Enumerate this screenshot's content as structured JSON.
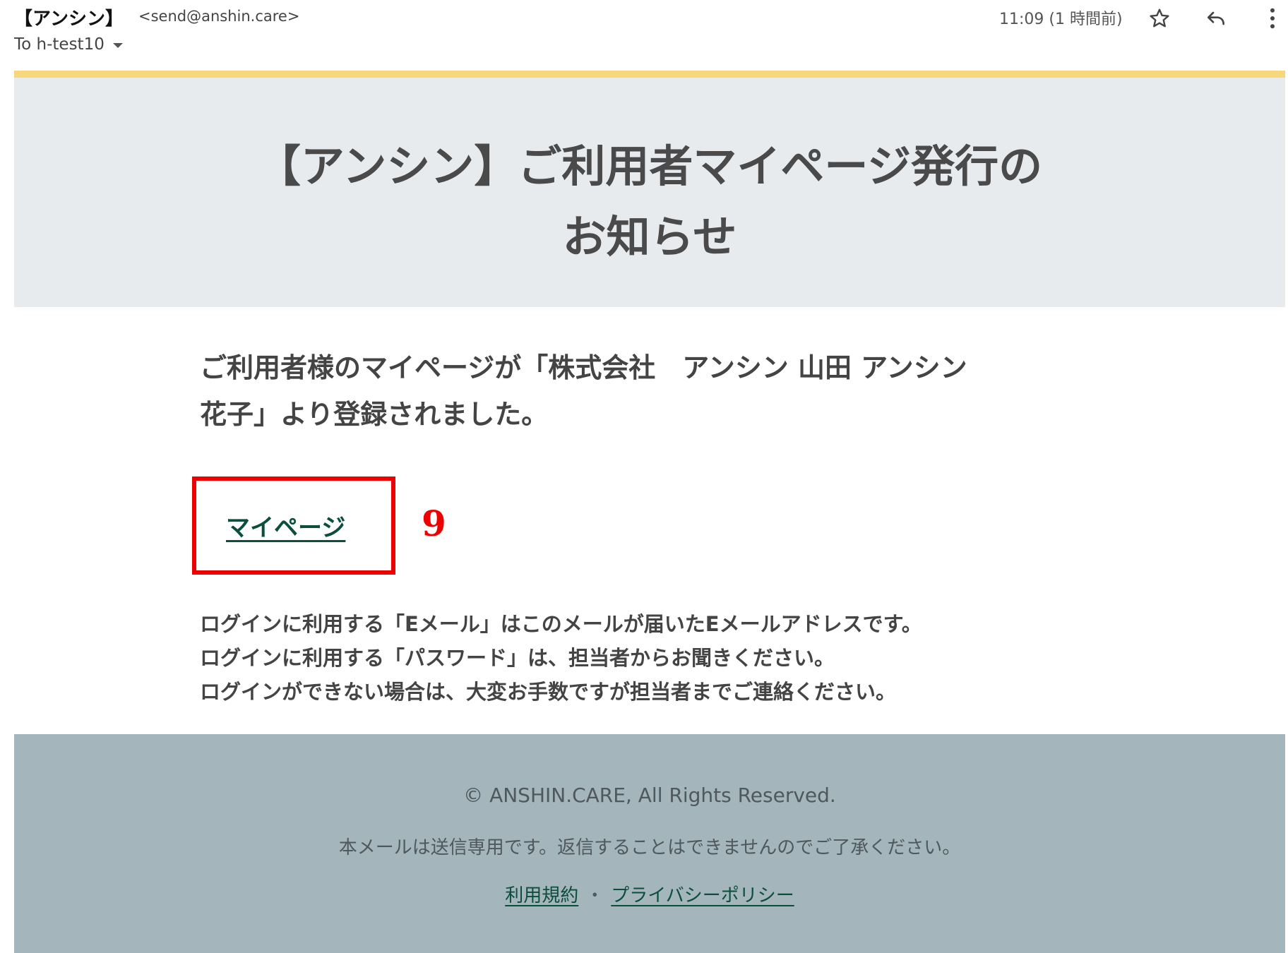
{
  "header": {
    "sender_name": "【アンシン】",
    "sender_email": "<send@anshin.care>",
    "recipient": "To h-test10",
    "timestamp": "11:09 (1 時間前)",
    "icons": [
      "star-icon",
      "reply-icon",
      "more-vert-icon",
      "chevron-down-icon"
    ]
  },
  "email": {
    "title_line1": "【アンシン】ご利用者マイページ発行の",
    "title_line2": "お知らせ",
    "intro_line1": "ご利用者様のマイページが「株式会社　アンシン 山田 アンシン",
    "intro_line2": "花子」より登録されました。",
    "mypage_link": "マイページ",
    "annotation_number": "9",
    "notes": [
      "ログインに利用する「Eメール」はこのメールが届いたEメールアドレスです。",
      "ログインに利用する「パスワード」は、担当者からお聞きください。",
      "ログインができない場合は、大変お手数ですが担当者までご連絡ください。"
    ]
  },
  "footer": {
    "copyright": "© ANSHIN.CARE, All Rights Reserved.",
    "no_reply": "本メールは送信専用です。返信することはできませんのでご了承ください。",
    "terms_link": "利用規約",
    "separator": "・",
    "privacy_link": "プライバシーポリシー"
  },
  "colors": {
    "accent_bar": "#f7d77a",
    "title_bg": "#e8ebee",
    "footer_bg": "#a4b5bc",
    "link": "#0a4e3c",
    "annotation": "#ee0000"
  }
}
